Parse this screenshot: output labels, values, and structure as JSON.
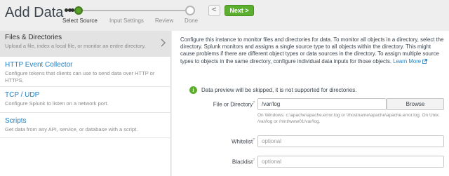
{
  "header": {
    "title": "Add Data",
    "back_label": "<",
    "next_label": "Next >"
  },
  "wizard": {
    "steps": [
      "Select Source",
      "Input Settings",
      "Review",
      "Done"
    ],
    "current": 0
  },
  "sidebar": {
    "items": [
      {
        "title": "Files & Directories",
        "desc": "Upload a file, index a local file, or monitor an entire directory.",
        "selected": true
      },
      {
        "title": "HTTP Event Collector",
        "desc": "Configure tokens that clients can use to send data over HTTP or HTTPS."
      },
      {
        "title": "TCP / UDP",
        "desc": "Configure Splunk to listen on a network port."
      },
      {
        "title": "Scripts",
        "desc": "Get data from any API, service, or database with a script."
      }
    ]
  },
  "main": {
    "description": "Configure this instance to monitor files and directories for data. To monitor all objects in a directory, select the directory. Splunk monitors and assigns a single source type to all objects within the directory. This might cause problems if there are different object types or data sources in the directory. To assign multiple source types to objects in the same directory, configure individual data inputs for those objects.",
    "learn_more": "Learn More",
    "info_icon": "i",
    "info": "Data preview will be skipped, it is not supported for directories.",
    "file_label": "File or Directory",
    "file_value": "/var/log",
    "browse_label": "Browse",
    "hint": "On Windows: c:\\apache\\apache.error.log or \\\\hostname\\apache\\apache.error.log. On Unix: /var/log or /mnt/www01/var/log.",
    "whitelist_label": "Whitelist",
    "whitelist_placeholder": "optional",
    "blacklist_label": "Blacklist",
    "blacklist_placeholder": "optional",
    "help_mark": "?"
  },
  "colors": {
    "accent": "#5cae2e",
    "link": "#1e7ec1"
  }
}
